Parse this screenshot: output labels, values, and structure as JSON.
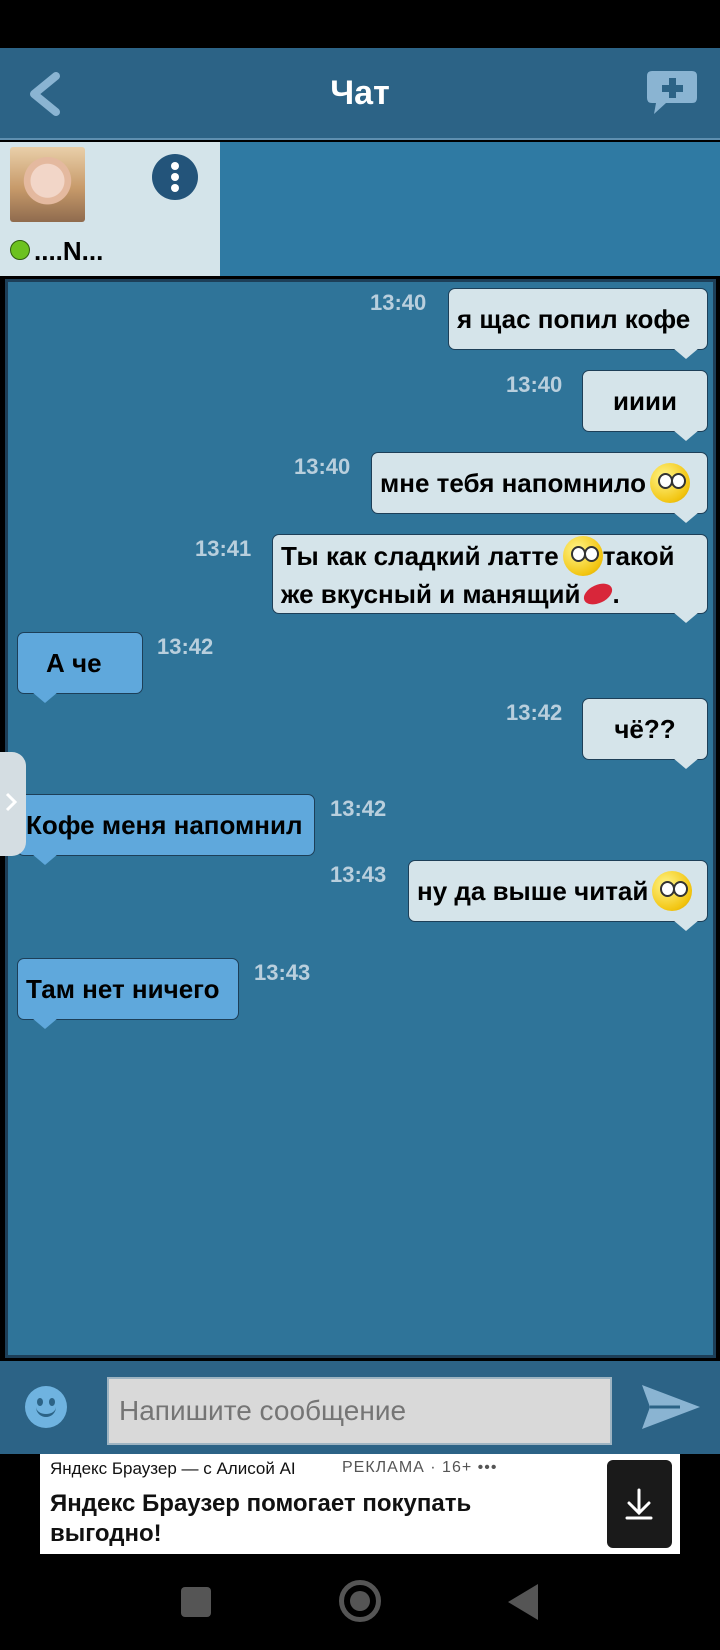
{
  "header": {
    "title": "Чат"
  },
  "contact": {
    "name": "....N..."
  },
  "messages": [
    {
      "time": "13:40",
      "dir": "out",
      "text": "я щас попил кофе"
    },
    {
      "time": "13:40",
      "dir": "out",
      "text": "ииии"
    },
    {
      "time": "13:40",
      "dir": "out",
      "text": "мне тебя напомнило",
      "emoji": "rolling-eyes-emoji"
    },
    {
      "time": "13:41",
      "dir": "out",
      "text_1": "Ты как сладкий латте",
      "text_2": "такой",
      "text_3": "же вкусный и манящий",
      "text_4": "."
    },
    {
      "time": "13:42",
      "dir": "in",
      "text": "А че"
    },
    {
      "time": "13:42",
      "dir": "out",
      "text": "чё??"
    },
    {
      "time": "13:42",
      "dir": "in",
      "text": "Кофе меня напомнил"
    },
    {
      "time": "13:43",
      "dir": "out",
      "text": "ну да выше читай",
      "emoji": "unamused-emoji"
    },
    {
      "time": "13:43",
      "dir": "in",
      "text": "Там нет ничего"
    }
  ],
  "composer": {
    "placeholder": "Напишите сообщение"
  },
  "ad": {
    "source": "Яндекс Браузер — с Алисой AI",
    "label": "РЕКЛАМА · 16+ •••",
    "headline": "Яндекс Браузер помогает покупать выгодно!"
  },
  "colors": {
    "header": "#2c6386",
    "chat_bg": "#2f7499",
    "bubble_out": "#d5e4ea",
    "bubble_in": "#5fa8dc",
    "online": "#6cc21f"
  }
}
